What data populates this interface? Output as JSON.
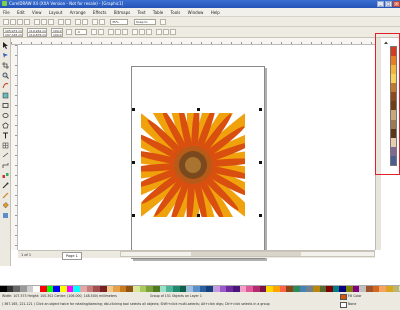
{
  "window": {
    "title": "CorelDRAW X4 (XXA Version - Not for resale) - [Graphic1]"
  },
  "menu": [
    "File",
    "Edit",
    "View",
    "Layout",
    "Arrange",
    "Effects",
    "Bitmaps",
    "Text",
    "Table",
    "Tools",
    "Window",
    "Help"
  ],
  "toolbar": {
    "zoom": "35%",
    "snap": "Snap to"
  },
  "propertybar": {
    "x": "105.972 mm",
    "y": "197.345 mm",
    "w": "119.961 mm",
    "h": "119.876 mm",
    "scale_w": "100.0",
    "scale_h": "100.0",
    "angle": ".0"
  },
  "document": {
    "page_label": "1 of 1",
    "page_tab": "Page 1"
  },
  "status": {
    "line1": "Width: 107.573  Height: 100.302  Center: (106.000, 148.500)  millimeters",
    "line1b": "Group of 151 Objects on Layer 1",
    "line2": "( 367.165, 221.121 )    Click an object twice for rotating/skewing; dbl-clicking tool selects all objects; Shift+click multi-selects; Alt+click digs; Ctrl+click selects in a group",
    "fill": "Fill Color",
    "outline": "None"
  },
  "colors": {
    "accent": "#e0202a",
    "title_bar": "#2453b8",
    "petal_outer": "#f0a20c",
    "petal_inner": "#d94f0f",
    "center": "#7a4a1e"
  },
  "palette_vertical": [
    "#d23c1f",
    "#e87d22",
    "#f2b43a",
    "#f7d25c",
    "#bf7a31",
    "#8c4a1d",
    "#6f3d16",
    "#c8a77a",
    "#9b7a55",
    "#5a3718",
    "#e6ccb0",
    "#7f6b90",
    "#4a5e8f"
  ],
  "palette_bottom": [
    "#000000",
    "#333333",
    "#666666",
    "#999999",
    "#cccccc",
    "#ffffff",
    "#ff0000",
    "#00ff00",
    "#0000ff",
    "#ffff00",
    "#ff00ff",
    "#00ffff",
    "#e1a8a8",
    "#c77b7b",
    "#a14f4f",
    "#7a2020",
    "#f2c88a",
    "#e6a04a",
    "#c97a1a",
    "#8f5313",
    "#d9e59b",
    "#a9c95a",
    "#7ba13a",
    "#4f7a20",
    "#9be0c8",
    "#4fb59a",
    "#1f8a6f",
    "#0f5f4a",
    "#9bbde0",
    "#5a8fc9",
    "#2a5fa1",
    "#143f7a",
    "#c49be0",
    "#9a5ac9",
    "#6f2aa1",
    "#4a147a",
    "#f2a0c8",
    "#e05a9a",
    "#b52a6f",
    "#7a1447",
    "#ffd700",
    "#ffa500",
    "#ff6347",
    "#8b4513",
    "#2e8b57",
    "#4682b4",
    "#708090",
    "#b8860b",
    "#556b2f",
    "#800000",
    "#008080",
    "#000080",
    "#808000",
    "#800080",
    "#c0c0c0",
    "#a0522d",
    "#d2691e",
    "#f4a460",
    "#daa520",
    "#bdb76b"
  ],
  "icons": [
    "pick-tool-icon",
    "shape-tool-icon",
    "crop-tool-icon",
    "zoom-tool-icon",
    "freehand-tool-icon",
    "smart-fill-icon",
    "rectangle-tool-icon",
    "ellipse-tool-icon",
    "polygon-tool-icon",
    "text-tool-icon",
    "table-tool-icon",
    "dimension-tool-icon",
    "connector-tool-icon",
    "blend-tool-icon",
    "eyedropper-tool-icon",
    "outline-tool-icon",
    "fill-tool-icon",
    "interactive-fill-icon"
  ]
}
